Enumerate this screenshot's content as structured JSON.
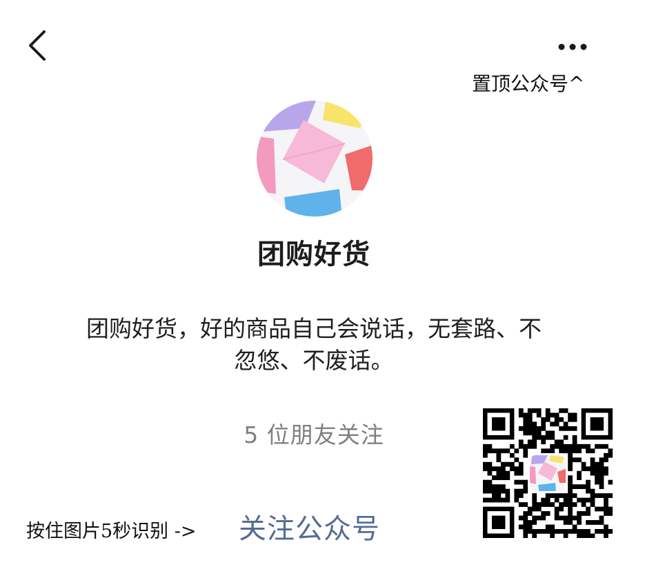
{
  "header": {
    "back_icon": "chevron-left-icon",
    "more_icon": "more-dots-icon",
    "pin_label": "置顶公众号^"
  },
  "profile": {
    "avatar_icon": "envelope-collage-avatar",
    "name": "团购好货",
    "description": "团购好货，好的商品自己会说话，无套路、不忽悠、不废话。",
    "friends_following": "5 位朋友关注"
  },
  "footer": {
    "hint": "按住图片5秒识别 ->",
    "follow_label": "关注公众号",
    "qrcode_icon": "qr-code-icon"
  },
  "colors": {
    "accent": "#566b95",
    "muted_text": "#7f7f7f",
    "primary_text": "#1d1d1d",
    "background": "#ffffff"
  }
}
